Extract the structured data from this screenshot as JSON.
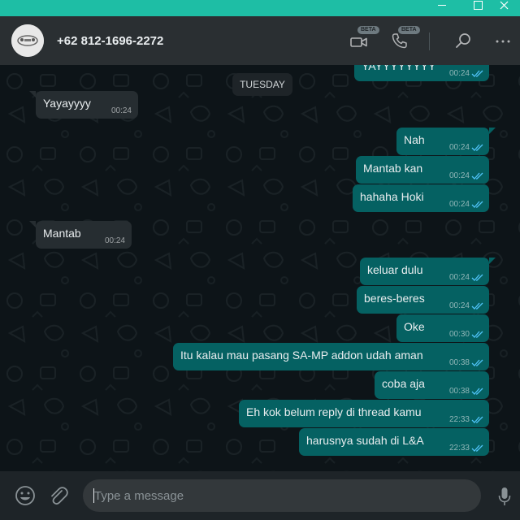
{
  "window": {
    "controls": [
      "minimize",
      "maximize",
      "close"
    ],
    "accent": "#1ebea5"
  },
  "header": {
    "contact_name": "+62 812-1696-2272",
    "video_beta": "BETA",
    "voice_beta": "BETA",
    "icons": [
      "video-call-icon",
      "voice-call-icon",
      "search-icon",
      "menu-icon"
    ]
  },
  "chat": {
    "day_label": "TUESDAY",
    "messages": [
      {
        "dir": "out",
        "text": "YAYYYYYYYY",
        "time": "00:24"
      },
      {
        "dir": "in",
        "text": "Yayayyyy",
        "time": "00:24"
      },
      {
        "dir": "out",
        "text": "Nah",
        "time": "00:24"
      },
      {
        "dir": "out",
        "text": "Mantab kan",
        "time": "00:24"
      },
      {
        "dir": "out",
        "text": "hahaha Hoki",
        "time": "00:24"
      },
      {
        "dir": "in",
        "text": "Mantab",
        "time": "00:24"
      },
      {
        "dir": "out",
        "text": "keluar dulu",
        "time": "00:24"
      },
      {
        "dir": "out",
        "text": "beres-beres",
        "time": "00:24"
      },
      {
        "dir": "out",
        "text": "Oke",
        "time": "00:30"
      },
      {
        "dir": "out",
        "text": "Itu kalau mau pasang SA-MP addon udah aman",
        "time": "00:38"
      },
      {
        "dir": "out",
        "text": "coba aja",
        "time": "00:38"
      },
      {
        "dir": "out",
        "text": "Eh kok belum reply di thread kamu",
        "time": "22:33"
      },
      {
        "dir": "out",
        "text": "harusnya sudah di L&A",
        "time": "22:33"
      }
    ],
    "colors": {
      "outgoing": "#056162",
      "incoming": "#262d31",
      "read_ticks": "#4fc3f7"
    }
  },
  "composer": {
    "placeholder": "Type a message"
  }
}
